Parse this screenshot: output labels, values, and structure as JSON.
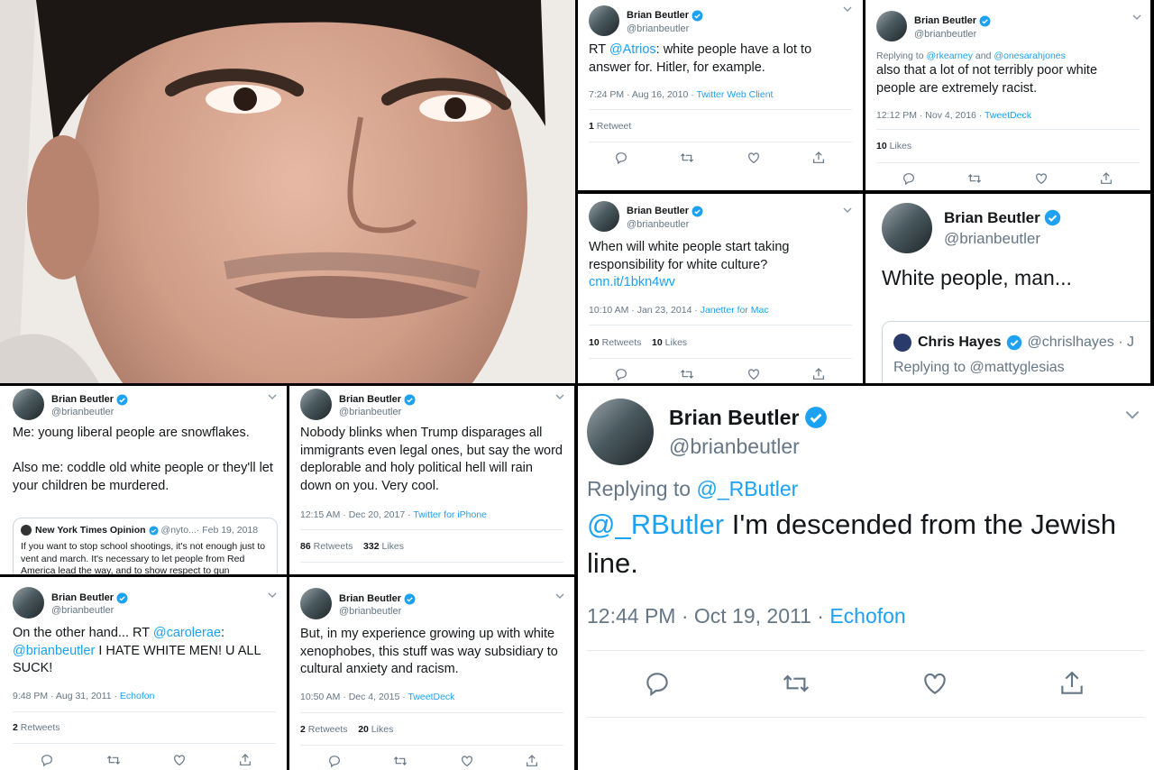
{
  "verified_color": "#1da1f2",
  "link_color": "#1da1f2",
  "icons": [
    "chevron-down-icon",
    "reply-icon",
    "retweet-icon",
    "like-icon",
    "share-icon",
    "verified-icon"
  ],
  "p1": {
    "name": "Brian Beutler",
    "handle": "@brianbeutler",
    "text_pre": "RT ",
    "mention": "@Atrios",
    "text_post": ": white people have a lot to answer for.  Hitler, for example.",
    "time": "7:24 PM · Aug 16, 2010 · ",
    "source": "Twitter Web Client",
    "stat1_num": "1",
    "stat1_label": " Retweet"
  },
  "p2": {
    "name": "Brian Beutler",
    "handle": "@brianbeutler",
    "reply_pre": "Replying to ",
    "reply_to1": "@rkearney",
    "reply_and": " and ",
    "reply_to2": "@onesarahjones",
    "text": "also that a lot of not terribly poor white people are extremely racist.",
    "time": "12:12 PM · Nov 4, 2016 · ",
    "source": "TweetDeck",
    "stat1_num": "10",
    "stat1_label": " Likes"
  },
  "p3": {
    "name": "Brian Beutler",
    "handle": "@brianbeutler",
    "text": "When will white people start taking responsibility for white culture?",
    "link": "cnn.it/1bkn4wv",
    "time": "10:10 AM · Jan 23, 2014 · ",
    "source": "Janetter for Mac",
    "stat1_num": "10",
    "stat1_label": " Retweets",
    "stat2_num": "10",
    "stat2_label": " Likes"
  },
  "p4": {
    "name": "Brian Beutler",
    "handle": "@brianbeutler",
    "text": "White people, man...",
    "quote_name": "Chris Hayes",
    "quote_handle": "@chrislhayes · J",
    "quote_reply": "Replying to @mattyglesias"
  },
  "p5": {
    "name": "Brian Beutler",
    "handle": "@brianbeutler",
    "text": "Me: young liberal people are snowflakes.\n\nAlso me: coddle old white people or they'll let your children be murdered.",
    "quote_name": "New York Times Opinion",
    "quote_handle": "@nyto...",
    "quote_date": " · Feb 19, 2018",
    "quote_text": "If you want to stop school shootings, it's not enough just to vent and march. It's necessary to let people from Red America lead the way, and to show respect to gun"
  },
  "p6": {
    "name": "Brian Beutler",
    "handle": "@brianbeutler",
    "text": "Nobody blinks when Trump disparages all immigrants even legal ones, but say the word deplorable and holy political hell will rain down on you. Very cool.",
    "time": "12:15 AM · Dec 20, 2017 · ",
    "source": "Twitter for iPhone",
    "stat1_num": "86",
    "stat1_label": " Retweets",
    "stat2_num": "332",
    "stat2_label": " Likes"
  },
  "p7": {
    "name": "Brian Beutler",
    "handle": "@brianbeutler",
    "text_pre": "On the other hand... RT ",
    "mention1": "@carolerae",
    "text_mid": ":",
    "mention2": "@brianbeutler",
    "text_post": " I HATE WHITE MEN! U ALL SUCK!",
    "time": "9:48 PM · Aug 31, 2011 · ",
    "source": "Echofon",
    "stat1_num": "2",
    "stat1_label": " Retweets"
  },
  "p8": {
    "name": "Brian Beutler",
    "handle": "@brianbeutler",
    "text": "But, in my experience growing up with white xenophobes, this stuff was way subsidiary to cultural anxiety and racism.",
    "time": "10:50 AM · Dec 4, 2015 · ",
    "source": "TweetDeck",
    "stat1_num": "2",
    "stat1_label": " Retweets",
    "stat2_num": "20",
    "stat2_label": " Likes"
  },
  "p9": {
    "name": "Brian Beutler",
    "handle": "@brianbeutler",
    "reply_pre": "Replying to ",
    "reply_to": "@_RButler",
    "mention": "@_RButler",
    "text": " I'm descended from the Jewish line.",
    "time": "12:44 PM · Oct 19, 2011 · ",
    "source": "Echofon"
  }
}
